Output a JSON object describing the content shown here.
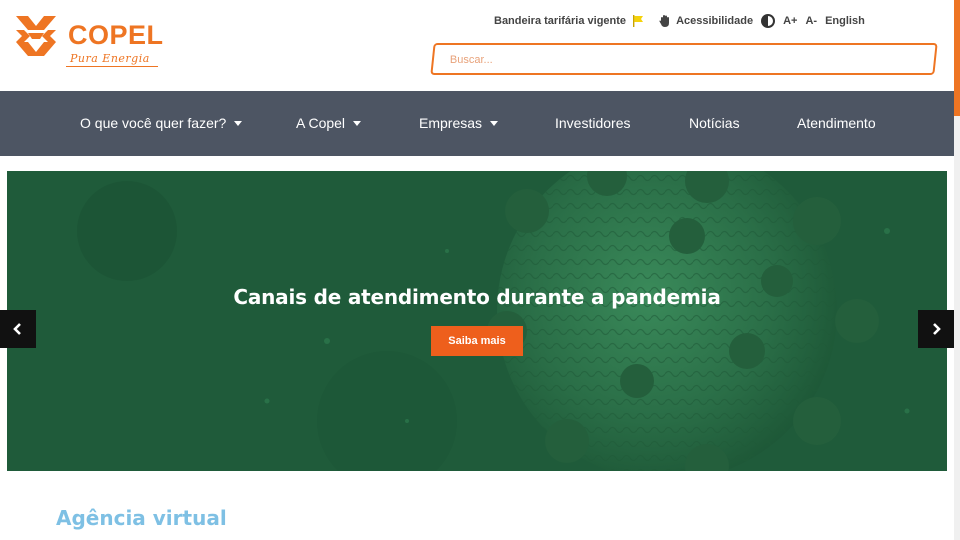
{
  "brand": {
    "name": "COPEL",
    "tagline": "Pura Energia",
    "color": "#ee7523"
  },
  "utility": {
    "bandeira_label": "Bandeira tarifária vigente",
    "bandeira_icon": "flag-icon",
    "bandeira_color": "#f5d20a",
    "acessibilidade_label": "Acessibilidade",
    "acessibilidade_icon": "hand-icon",
    "contrast_icon": "contrast-icon",
    "font_increase": "A+",
    "font_decrease": "A-",
    "language": "English"
  },
  "search": {
    "placeholder": "Buscar..."
  },
  "nav": {
    "background": "#4d5563",
    "items": [
      {
        "label": "O que você quer fazer?",
        "dropdown": true
      },
      {
        "label": "A Copel",
        "dropdown": true
      },
      {
        "label": "Empresas",
        "dropdown": true
      },
      {
        "label": "Investidores",
        "dropdown": false
      },
      {
        "label": "Notícias",
        "dropdown": false
      },
      {
        "label": "Atendimento",
        "dropdown": false
      }
    ]
  },
  "hero": {
    "title": "Canais de atendimento durante a pandemia",
    "button_label": "Saiba mais",
    "button_color": "#ee5f1c",
    "background": "#1f5b3a",
    "prev_icon": "chevron-left-icon",
    "next_icon": "chevron-right-icon"
  },
  "section": {
    "title": "Agência virtual",
    "color": "#7ec0e4"
  }
}
